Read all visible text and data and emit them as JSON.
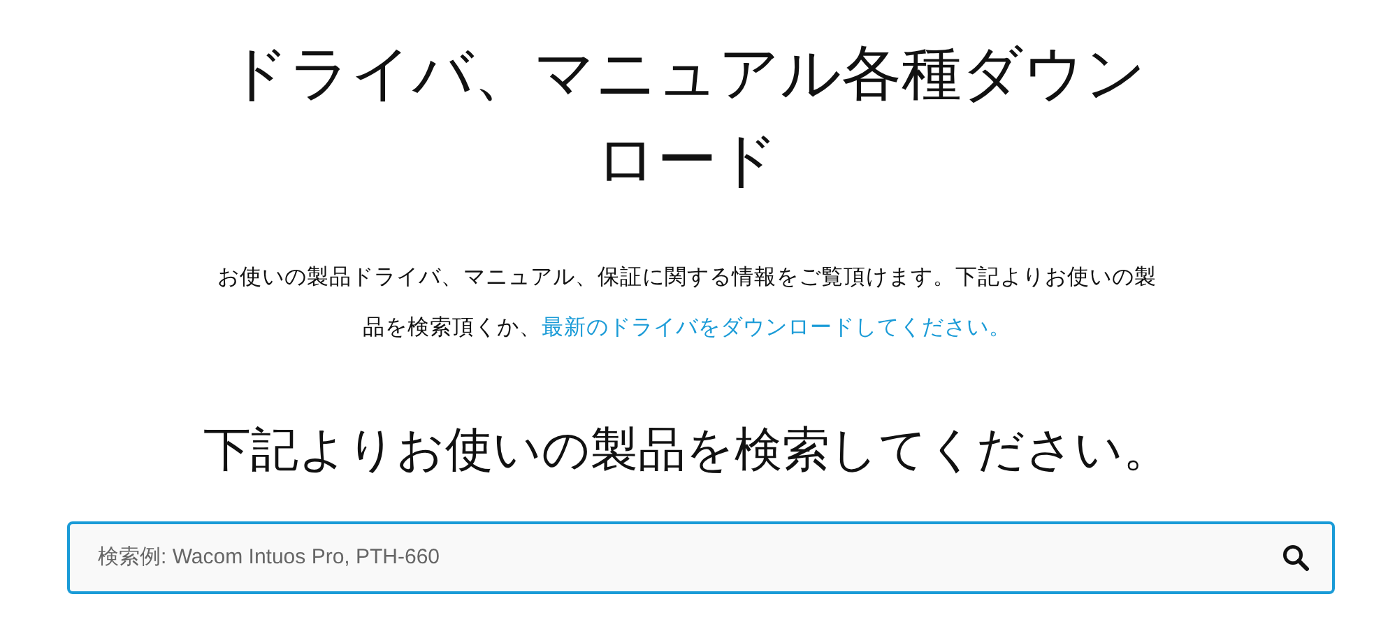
{
  "title": "ドライバ、マニュアル各種ダウンロード",
  "intro": {
    "text": "お使いの製品ドライバ、マニュアル、保証に関する情報をご覧頂けます。下記よりお使いの製品を検索頂くか、",
    "link": "最新のドライバをダウンロードしてください。"
  },
  "search_heading": "下記よりお使いの製品を検索してください。",
  "search": {
    "placeholder": "検索例: Wacom Intuos Pro, PTH-660"
  }
}
